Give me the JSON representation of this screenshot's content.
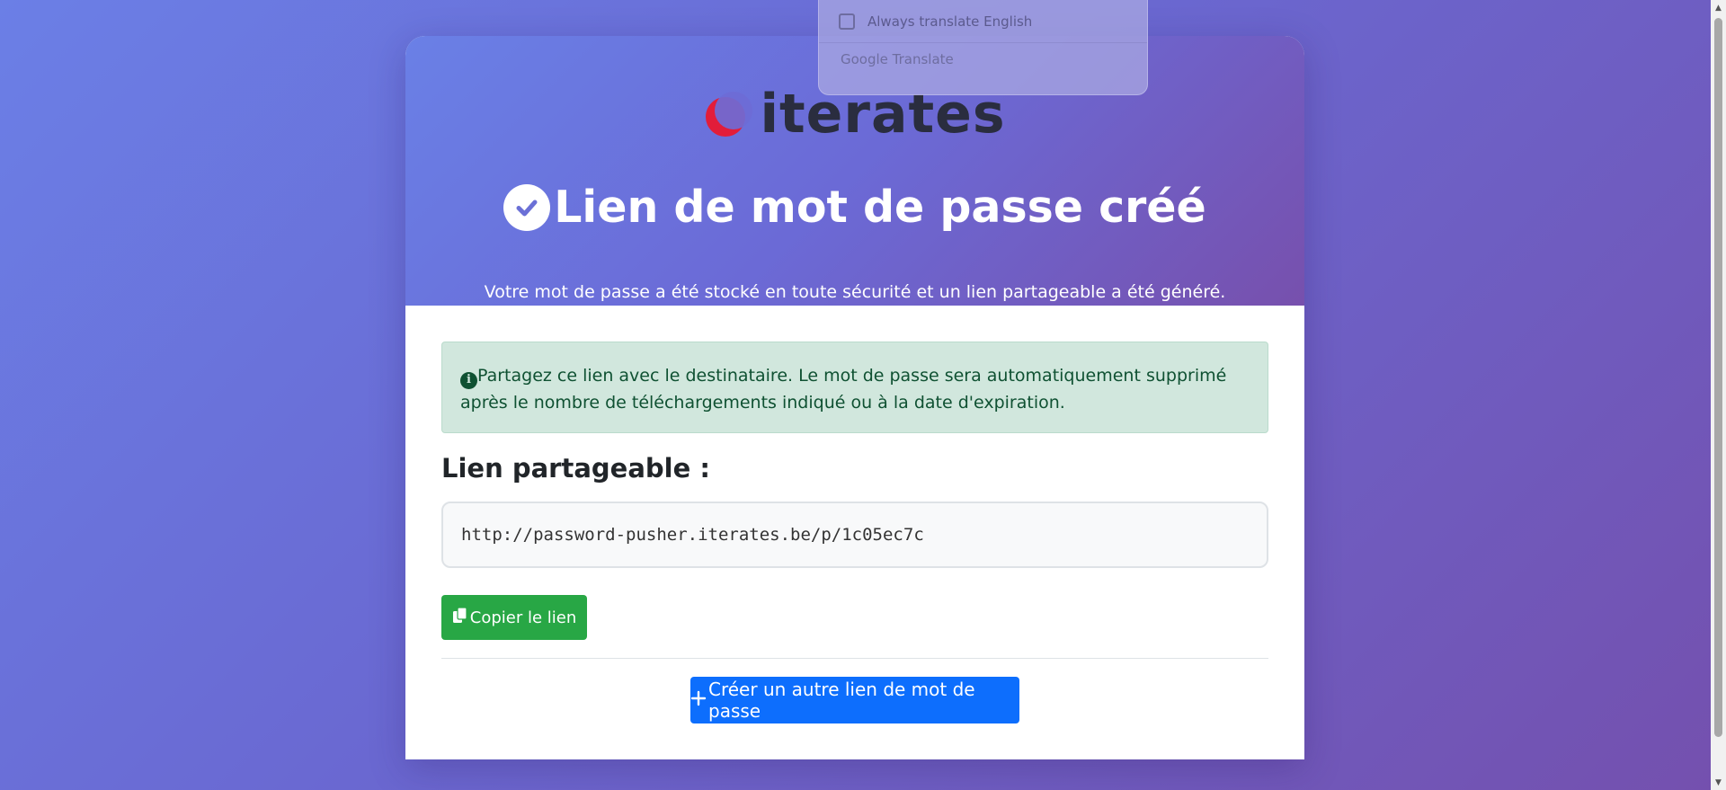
{
  "header": {
    "logo_text": "iterates",
    "title": "Lien de mot de passe créé",
    "subtitle": "Votre mot de passe a été stocké en toute sécurité et un lien partageable a été généré."
  },
  "alert": {
    "icon": "info-icon",
    "text": "Partagez ce lien avec le destinataire. Le mot de passe sera automatiquement supprimé après le nombre de téléchargements indiqué ou à la date d'expiration."
  },
  "share": {
    "label": "Lien partageable :",
    "url": "http://password-pusher.iterates.be/p/1c05ec7c",
    "copy_label": "Copier le lien"
  },
  "create": {
    "label": "Créer un autre lien de mot de passe"
  },
  "translate_popup": {
    "checkbox_label": "Always translate English",
    "checked": false,
    "brand": "Google Translate"
  },
  "colors": {
    "success": "#28a745",
    "primary": "#0d6efd",
    "alert_bg": "#d1e7dd",
    "logo_red": "#e21d3a"
  }
}
